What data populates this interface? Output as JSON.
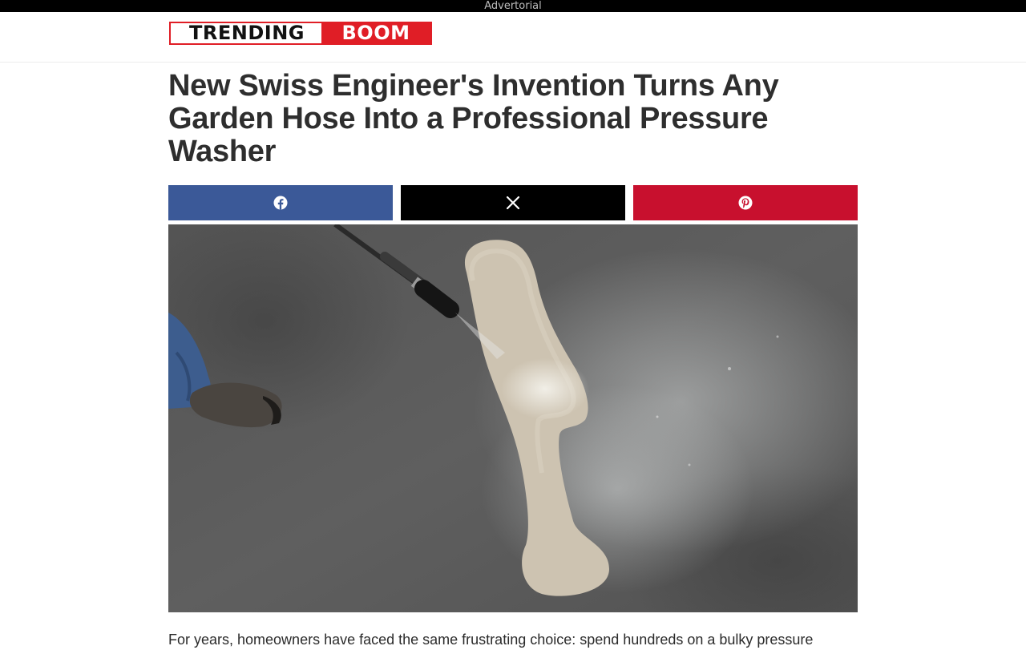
{
  "ad_bar": {
    "label": "Advertorial"
  },
  "header": {
    "logo_part1": "TRENDING",
    "logo_part2": "BOOM",
    "colors": {
      "brand_red": "#e01e26",
      "brand_dark": "#111111"
    }
  },
  "article": {
    "title": "New Swiss Engineer's Invention Turns Any Garden Hose Into a Professional Pressure Washer",
    "intro": "For years, homeowners have faced the same frustrating choice: spend hundreds on a bulky pressure",
    "hero_image": {
      "subject": "pressure-washing-concrete-photo"
    }
  },
  "share": {
    "buttons": [
      {
        "network": "facebook",
        "icon": "facebook-icon",
        "color": "#3b5998"
      },
      {
        "network": "x",
        "icon": "x-icon",
        "color": "#000000"
      },
      {
        "network": "pinterest",
        "icon": "pinterest-icon",
        "color": "#c8102e"
      }
    ]
  }
}
